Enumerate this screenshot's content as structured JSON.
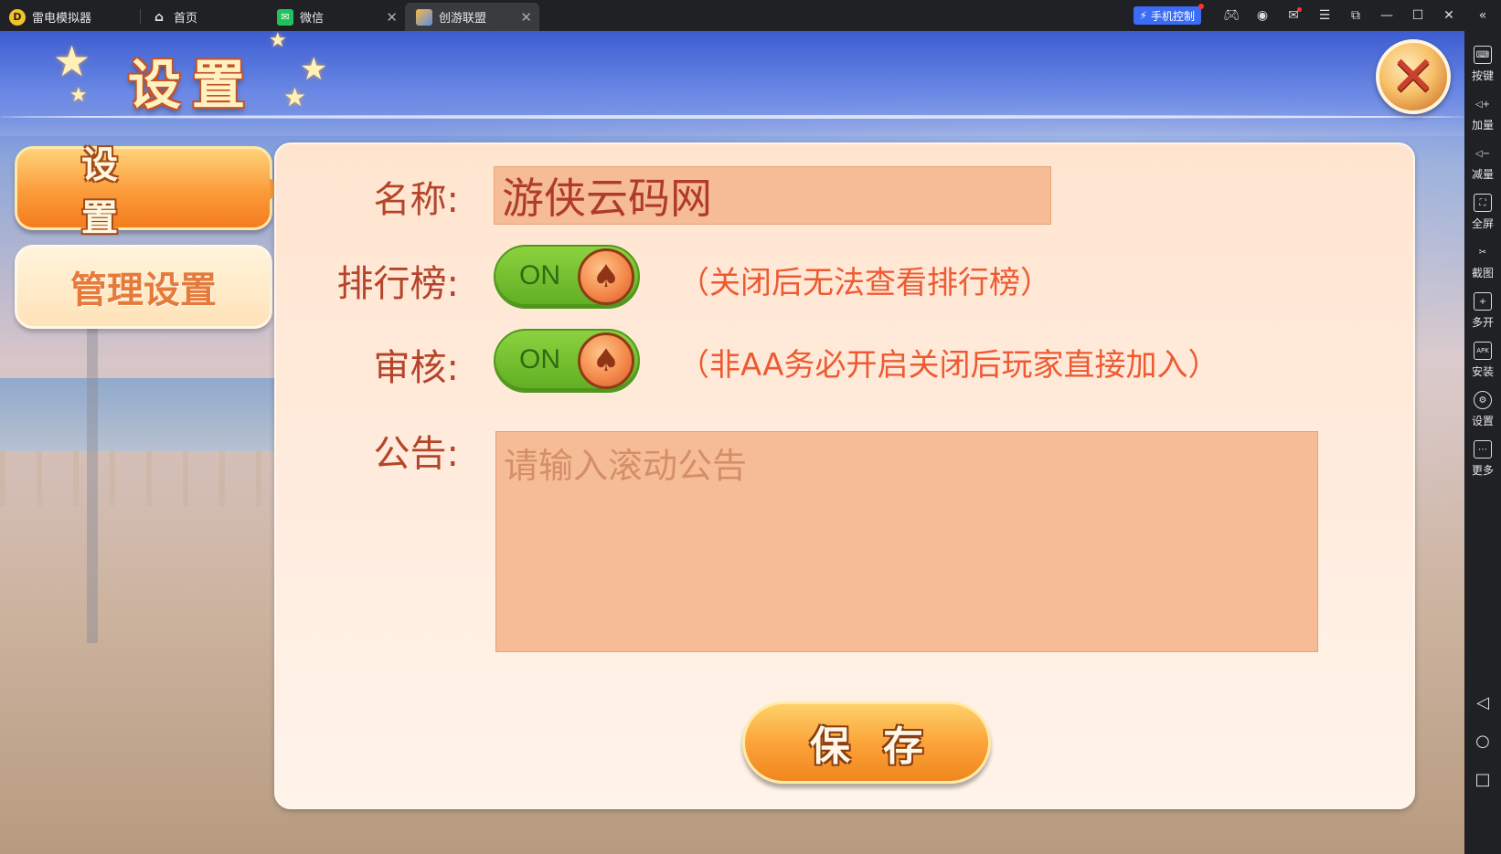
{
  "titlebar": {
    "app_name": "雷电模拟器",
    "tabs": [
      {
        "label": "首页",
        "icon": "home-icon"
      },
      {
        "label": "微信",
        "icon": "wechat-icon"
      },
      {
        "label": "创游联盟",
        "icon": "game-app-icon"
      }
    ],
    "phone_control_label": "手机控制",
    "buttons": [
      "gamepad-icon",
      "account-icon",
      "mail-icon",
      "menu-icon",
      "popout-icon",
      "minimize-icon",
      "maximize-icon",
      "close-icon",
      "collapse-sidebar-icon"
    ]
  },
  "sidebar": {
    "items": [
      {
        "label": "按键",
        "icon": "keyboard-icon"
      },
      {
        "label": "加量",
        "icon": "volume-up-icon"
      },
      {
        "label": "减量",
        "icon": "volume-down-icon"
      },
      {
        "label": "全屏",
        "icon": "fullscreen-icon"
      },
      {
        "label": "截图",
        "icon": "screenshot-icon"
      },
      {
        "label": "多开",
        "icon": "multi-instance-icon"
      },
      {
        "label": "安装",
        "icon": "apk-install-icon"
      },
      {
        "label": "设置",
        "icon": "settings-icon"
      },
      {
        "label": "更多",
        "icon": "more-icon"
      }
    ],
    "nav": [
      "back-icon",
      "home-circle-icon",
      "recent-apps-icon"
    ]
  },
  "game": {
    "title": "设置",
    "menu": {
      "settings_label": "设置",
      "manage_label": "管理设置"
    },
    "form": {
      "name_label": "名称:",
      "name_value": "游侠云码网",
      "ranking_label": "排行榜:",
      "ranking_toggle": "ON",
      "ranking_note": "（关闭后无法查看排行榜）",
      "review_label": "审核:",
      "review_toggle": "ON",
      "review_note": "（非AA务必开启关闭后玩家直接加入）",
      "notice_label": "公告:",
      "notice_placeholder": "请输入滚动公告"
    },
    "save_label": "保存"
  }
}
